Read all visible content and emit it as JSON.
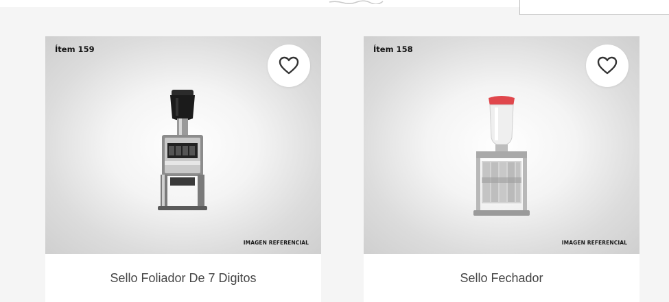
{
  "products": [
    {
      "item_label": "Ítem 159",
      "title": "Sello Foliador De 7 Digitos",
      "reference_label": "IMAGEN REFERENCIAL",
      "image_icon": "numbering-stamp-icon",
      "favorite_icon": "heart-outline-icon"
    },
    {
      "item_label": "Ítem 158",
      "title": "Sello Fechador",
      "reference_label": "IMAGEN REFERENCIAL",
      "image_icon": "date-stamp-icon",
      "favorite_icon": "heart-outline-icon"
    }
  ],
  "colors": {
    "background": "#f5f5f5",
    "card": "#ffffff",
    "title_text": "#444444",
    "stamp_red": "#e0474c"
  }
}
